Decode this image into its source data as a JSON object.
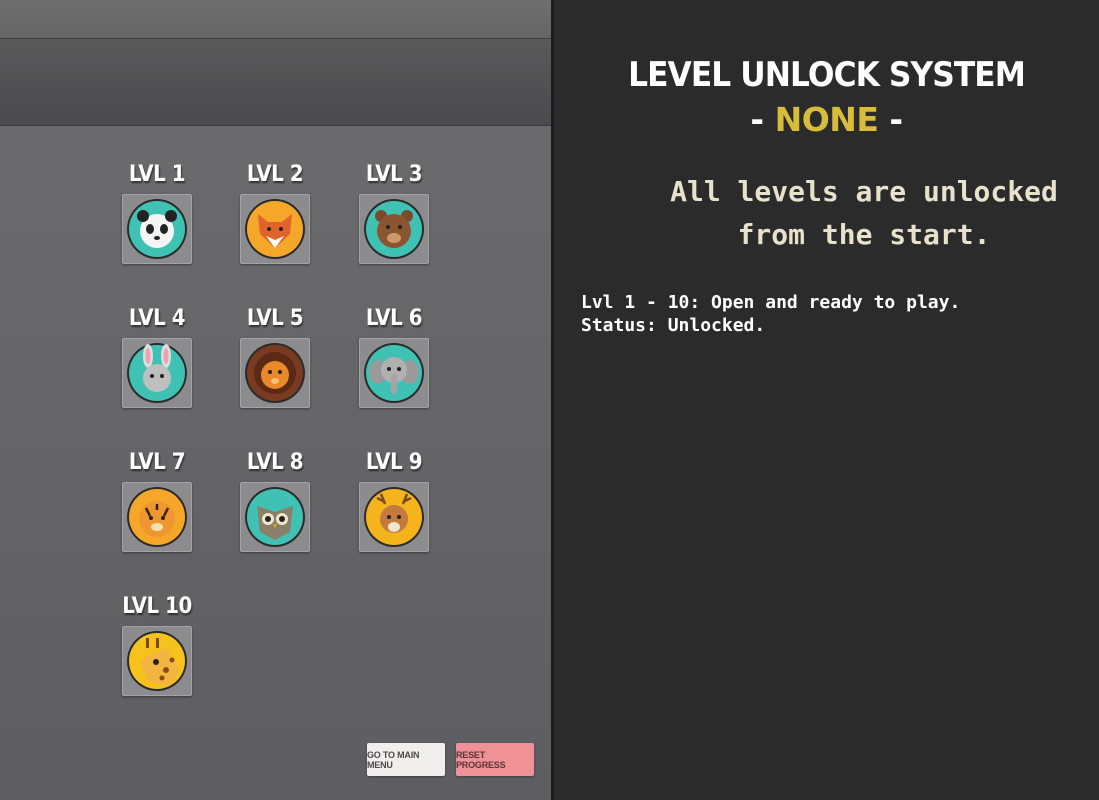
{
  "levels": [
    {
      "label": "LVL 1",
      "animal": "panda-icon",
      "bg": "#3fc2b4"
    },
    {
      "label": "LVL 2",
      "animal": "fox-icon",
      "bg": "#f6a72a"
    },
    {
      "label": "LVL 3",
      "animal": "bear-icon",
      "bg": "#3fc2b4"
    },
    {
      "label": "LVL 4",
      "animal": "rabbit-icon",
      "bg": "#3fc2b4"
    },
    {
      "label": "LVL 5",
      "animal": "lion-icon",
      "bg": "#7a3a22"
    },
    {
      "label": "LVL 6",
      "animal": "elephant-icon",
      "bg": "#3fc2b4"
    },
    {
      "label": "LVL 7",
      "animal": "tiger-icon",
      "bg": "#f6a72a"
    },
    {
      "label": "LVL 8",
      "animal": "owl-icon",
      "bg": "#3fc2b4"
    },
    {
      "label": "LVL 9",
      "animal": "deer-icon",
      "bg": "#f6b41c"
    },
    {
      "label": "LVL 10",
      "animal": "giraffe-icon",
      "bg": "#f6c21c"
    }
  ],
  "buttons": {
    "main_menu": "GO TO MAIN MENU",
    "reset": "RESET PROGRESS"
  },
  "info": {
    "title": "LEVEL UNLOCK SYSTEM",
    "mode_prefix": "- ",
    "mode_value": "NONE",
    "mode_suffix": " -",
    "description_line1": "All levels are unlocked",
    "description_line2": "from the start.",
    "detail_line1": "Lvl 1 - 10: Open and ready to play.",
    "detail_line2": "Status: Unlocked."
  },
  "colors": {
    "accent_yellow": "#d8bd3a",
    "menu_button": "#f1eeee",
    "reset_button": "#ef9196"
  }
}
